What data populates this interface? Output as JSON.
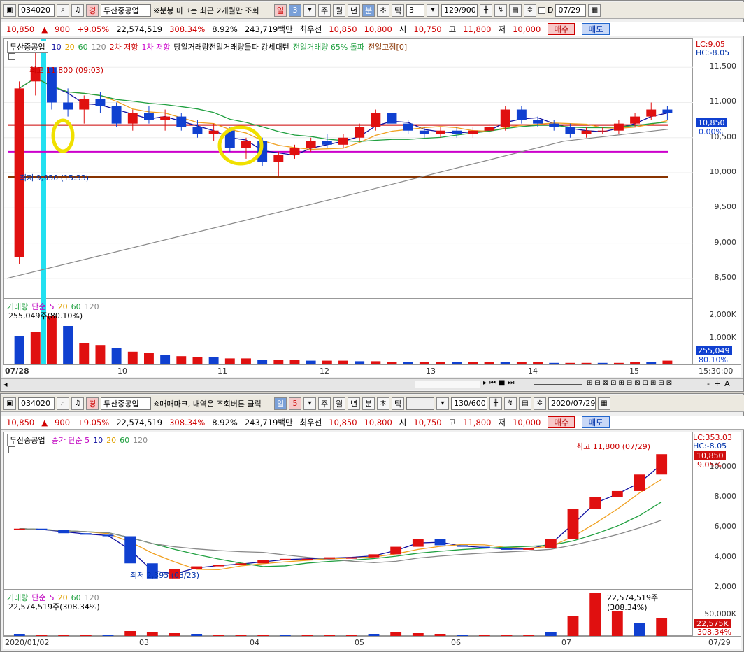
{
  "top": {
    "toolbar": {
      "code": "034020",
      "search_icon": "search-icon",
      "market_mark": "경",
      "stock_name": "두산중공업",
      "notice": "※분봉 마크는 최근 2개월만 조회",
      "period_seg": [
        "일",
        "3"
      ],
      "tabs": [
        "주",
        "월",
        "년",
        "분",
        "초",
        "틱"
      ],
      "active_tab": "분",
      "interval": "3",
      "count": "129/900",
      "date": "07/29"
    },
    "quote": {
      "price": "10,850",
      "arrow": "▲",
      "change": "900",
      "change_pct": "+9.05%",
      "volume": "22,574,519",
      "vol_ratio": "308.34%",
      "turnover": "8.92%",
      "amount": "243,719백만",
      "best_label": "최우선",
      "ask": "10,850",
      "bid": "10,800",
      "open_label": "시",
      "open": "10,750",
      "high_label": "고",
      "high": "11,800",
      "low_label": "저",
      "low": "10,000",
      "buy": "매수",
      "sell": "매도"
    },
    "legend": {
      "name": "두산중공업",
      "ma": [
        "10",
        "20",
        "60",
        "120"
      ],
      "r2": "2차 저항",
      "r1": "1차 저항",
      "pattern": "당일거래량전일거래량돌파 강세패턴",
      "prevvol": "전일거래량 65% 돌파",
      "prevhigh": "전일고점[0]"
    },
    "annotations": {
      "high": "최고 11,800 (09:03)",
      "low": "최저 9,950 (15:33)",
      "lc": "LC:9.05",
      "hc": "HC:-8.05",
      "price_tag": "10,850",
      "pct_tag": "0.00%"
    },
    "y_ticks": [
      "11,500",
      "11,000",
      "10,500",
      "10,000",
      "9,500",
      "9,000",
      "8,500"
    ],
    "volume": {
      "legend": [
        "거래량",
        "단순",
        "5",
        "20",
        "60",
        "120"
      ],
      "info": "255,049주(80.10%)",
      "y_ticks": [
        "2,000K",
        "1,000K"
      ],
      "tag": "255,049",
      "tag2": "80.10%"
    },
    "x_ticks": [
      "07/28",
      "10",
      "11",
      "12",
      "13",
      "14",
      "15"
    ],
    "time_end": "15:30:00",
    "colors": {
      "up": "#e01010",
      "down": "#1040d0",
      "ma5": "#1010a0",
      "ma20": "#f0a020",
      "ma60": "#20a040",
      "ma120": "#888888"
    }
  },
  "bottom": {
    "toolbar": {
      "code": "034020",
      "market_mark": "경",
      "stock_name": "두산중공업",
      "notice": "※매매마크, 내역은 조회버튼 클릭",
      "period_seg": [
        "일",
        "5"
      ],
      "tabs": [
        "주",
        "월",
        "년",
        "분",
        "초",
        "틱"
      ],
      "active_tab": "일",
      "count": "130/600",
      "date": "2020/07/29"
    },
    "quote": {
      "price": "10,850",
      "arrow": "▲",
      "change": "900",
      "change_pct": "+9.05%",
      "volume": "22,574,519",
      "vol_ratio": "308.34%",
      "turnover": "8.92%",
      "amount": "243,719백만",
      "best_label": "최우선",
      "ask": "10,850",
      "bid": "10,800",
      "open_label": "시",
      "open": "10,750",
      "high_label": "고",
      "high": "11,800",
      "low_label": "저",
      "low": "10,000",
      "buy": "매수",
      "sell": "매도"
    },
    "legend": {
      "name": "두산중공업",
      "close_ma": "종가 단순 5",
      "ma": [
        "10",
        "20",
        "60",
        "120"
      ]
    },
    "annotations": {
      "high": "최고 11,800 (07/29)",
      "low": "최저 2,395 (03/23)",
      "lc": "LC:353.03",
      "hc": "HC:-8.05",
      "price_tag": "10,850",
      "pct_tag": "9.05%"
    },
    "y_ticks": [
      "10,000",
      "8,000",
      "6,000",
      "4,000",
      "2,000"
    ],
    "volume": {
      "legend": [
        "거래량",
        "단순",
        "5",
        "20",
        "60",
        "120"
      ],
      "info": "22,574,519주(308.34%)",
      "info_right": "22,574,519주(308.34%)",
      "y_ticks": [
        "50,000K"
      ],
      "tag": "22,575K",
      "tag2": "308.34%"
    },
    "x_ticks": [
      "2020/01/02",
      "03",
      "04",
      "05",
      "06",
      "07"
    ],
    "date_end": "07/29"
  },
  "chart_data": [
    {
      "type": "candlestick",
      "title": "두산중공업 3분봉",
      "ylim": [
        8200,
        11900
      ],
      "levels": [
        {
          "name": "2차 저항",
          "value": 10680,
          "color": "#cc0000"
        },
        {
          "name": "1차 저항",
          "value": 10300,
          "color": "#cc00cc"
        },
        {
          "name": "전일고점",
          "value": 9940,
          "color": "#883300"
        }
      ],
      "ohlc": [
        [
          8800,
          11300,
          8700,
          11200
        ],
        [
          11300,
          11800,
          11100,
          11500
        ],
        [
          11500,
          11500,
          10900,
          11000
        ],
        [
          11000,
          11200,
          10800,
          10900
        ],
        [
          10900,
          11100,
          10700,
          11050
        ],
        [
          11050,
          11150,
          10850,
          10950
        ],
        [
          10950,
          11000,
          10650,
          10700
        ],
        [
          10700,
          10900,
          10600,
          10850
        ],
        [
          10850,
          10950,
          10700,
          10750
        ],
        [
          10750,
          10900,
          10600,
          10800
        ],
        [
          10800,
          10850,
          10600,
          10650
        ],
        [
          10650,
          10750,
          10500,
          10550
        ],
        [
          10550,
          10700,
          10450,
          10600
        ],
        [
          10600,
          10650,
          10300,
          10350
        ],
        [
          10350,
          10500,
          10200,
          10450
        ],
        [
          10450,
          10500,
          10100,
          10150
        ],
        [
          10150,
          10300,
          9950,
          10250
        ],
        [
          10250,
          10400,
          10200,
          10350
        ],
        [
          10350,
          10500,
          10300,
          10450
        ],
        [
          10450,
          10550,
          10350,
          10400
        ],
        [
          10400,
          10550,
          10350,
          10500
        ],
        [
          10500,
          10700,
          10450,
          10650
        ],
        [
          10650,
          10900,
          10600,
          10850
        ],
        [
          10850,
          10900,
          10650,
          10700
        ],
        [
          10700,
          10750,
          10550,
          10600
        ],
        [
          10600,
          10650,
          10500,
          10550
        ],
        [
          10550,
          10650,
          10500,
          10600
        ],
        [
          10600,
          10650,
          10500,
          10550
        ],
        [
          10550,
          10650,
          10500,
          10600
        ],
        [
          10600,
          10700,
          10550,
          10650
        ],
        [
          10650,
          10950,
          10600,
          10900
        ],
        [
          10900,
          10950,
          10700,
          10750
        ],
        [
          10750,
          10800,
          10650,
          10700
        ],
        [
          10700,
          10750,
          10600,
          10650
        ],
        [
          10650,
          10700,
          10500,
          10550
        ],
        [
          10550,
          10650,
          10500,
          10600
        ],
        [
          10600,
          10650,
          10550,
          10600
        ],
        [
          10600,
          10750,
          10550,
          10700
        ],
        [
          10700,
          10850,
          10650,
          10800
        ],
        [
          10800,
          11000,
          10750,
          10900
        ],
        [
          10900,
          10950,
          10750,
          10850
        ]
      ]
    },
    {
      "type": "candlestick",
      "title": "두산중공업 일봉",
      "ylim": [
        1800,
        12300
      ],
      "x": [
        "2020/01",
        "02",
        "03",
        "04",
        "05",
        "06",
        "07"
      ],
      "close": [
        5900,
        5800,
        5600,
        5500,
        5400,
        3600,
        2600,
        3200,
        3400,
        3500,
        3600,
        3800,
        3900,
        3900,
        4000,
        4000,
        4200,
        4700,
        5200,
        4800,
        4700,
        4600,
        4500,
        4600,
        5200,
        7200,
        8000,
        8400,
        9500,
        10850
      ]
    }
  ]
}
